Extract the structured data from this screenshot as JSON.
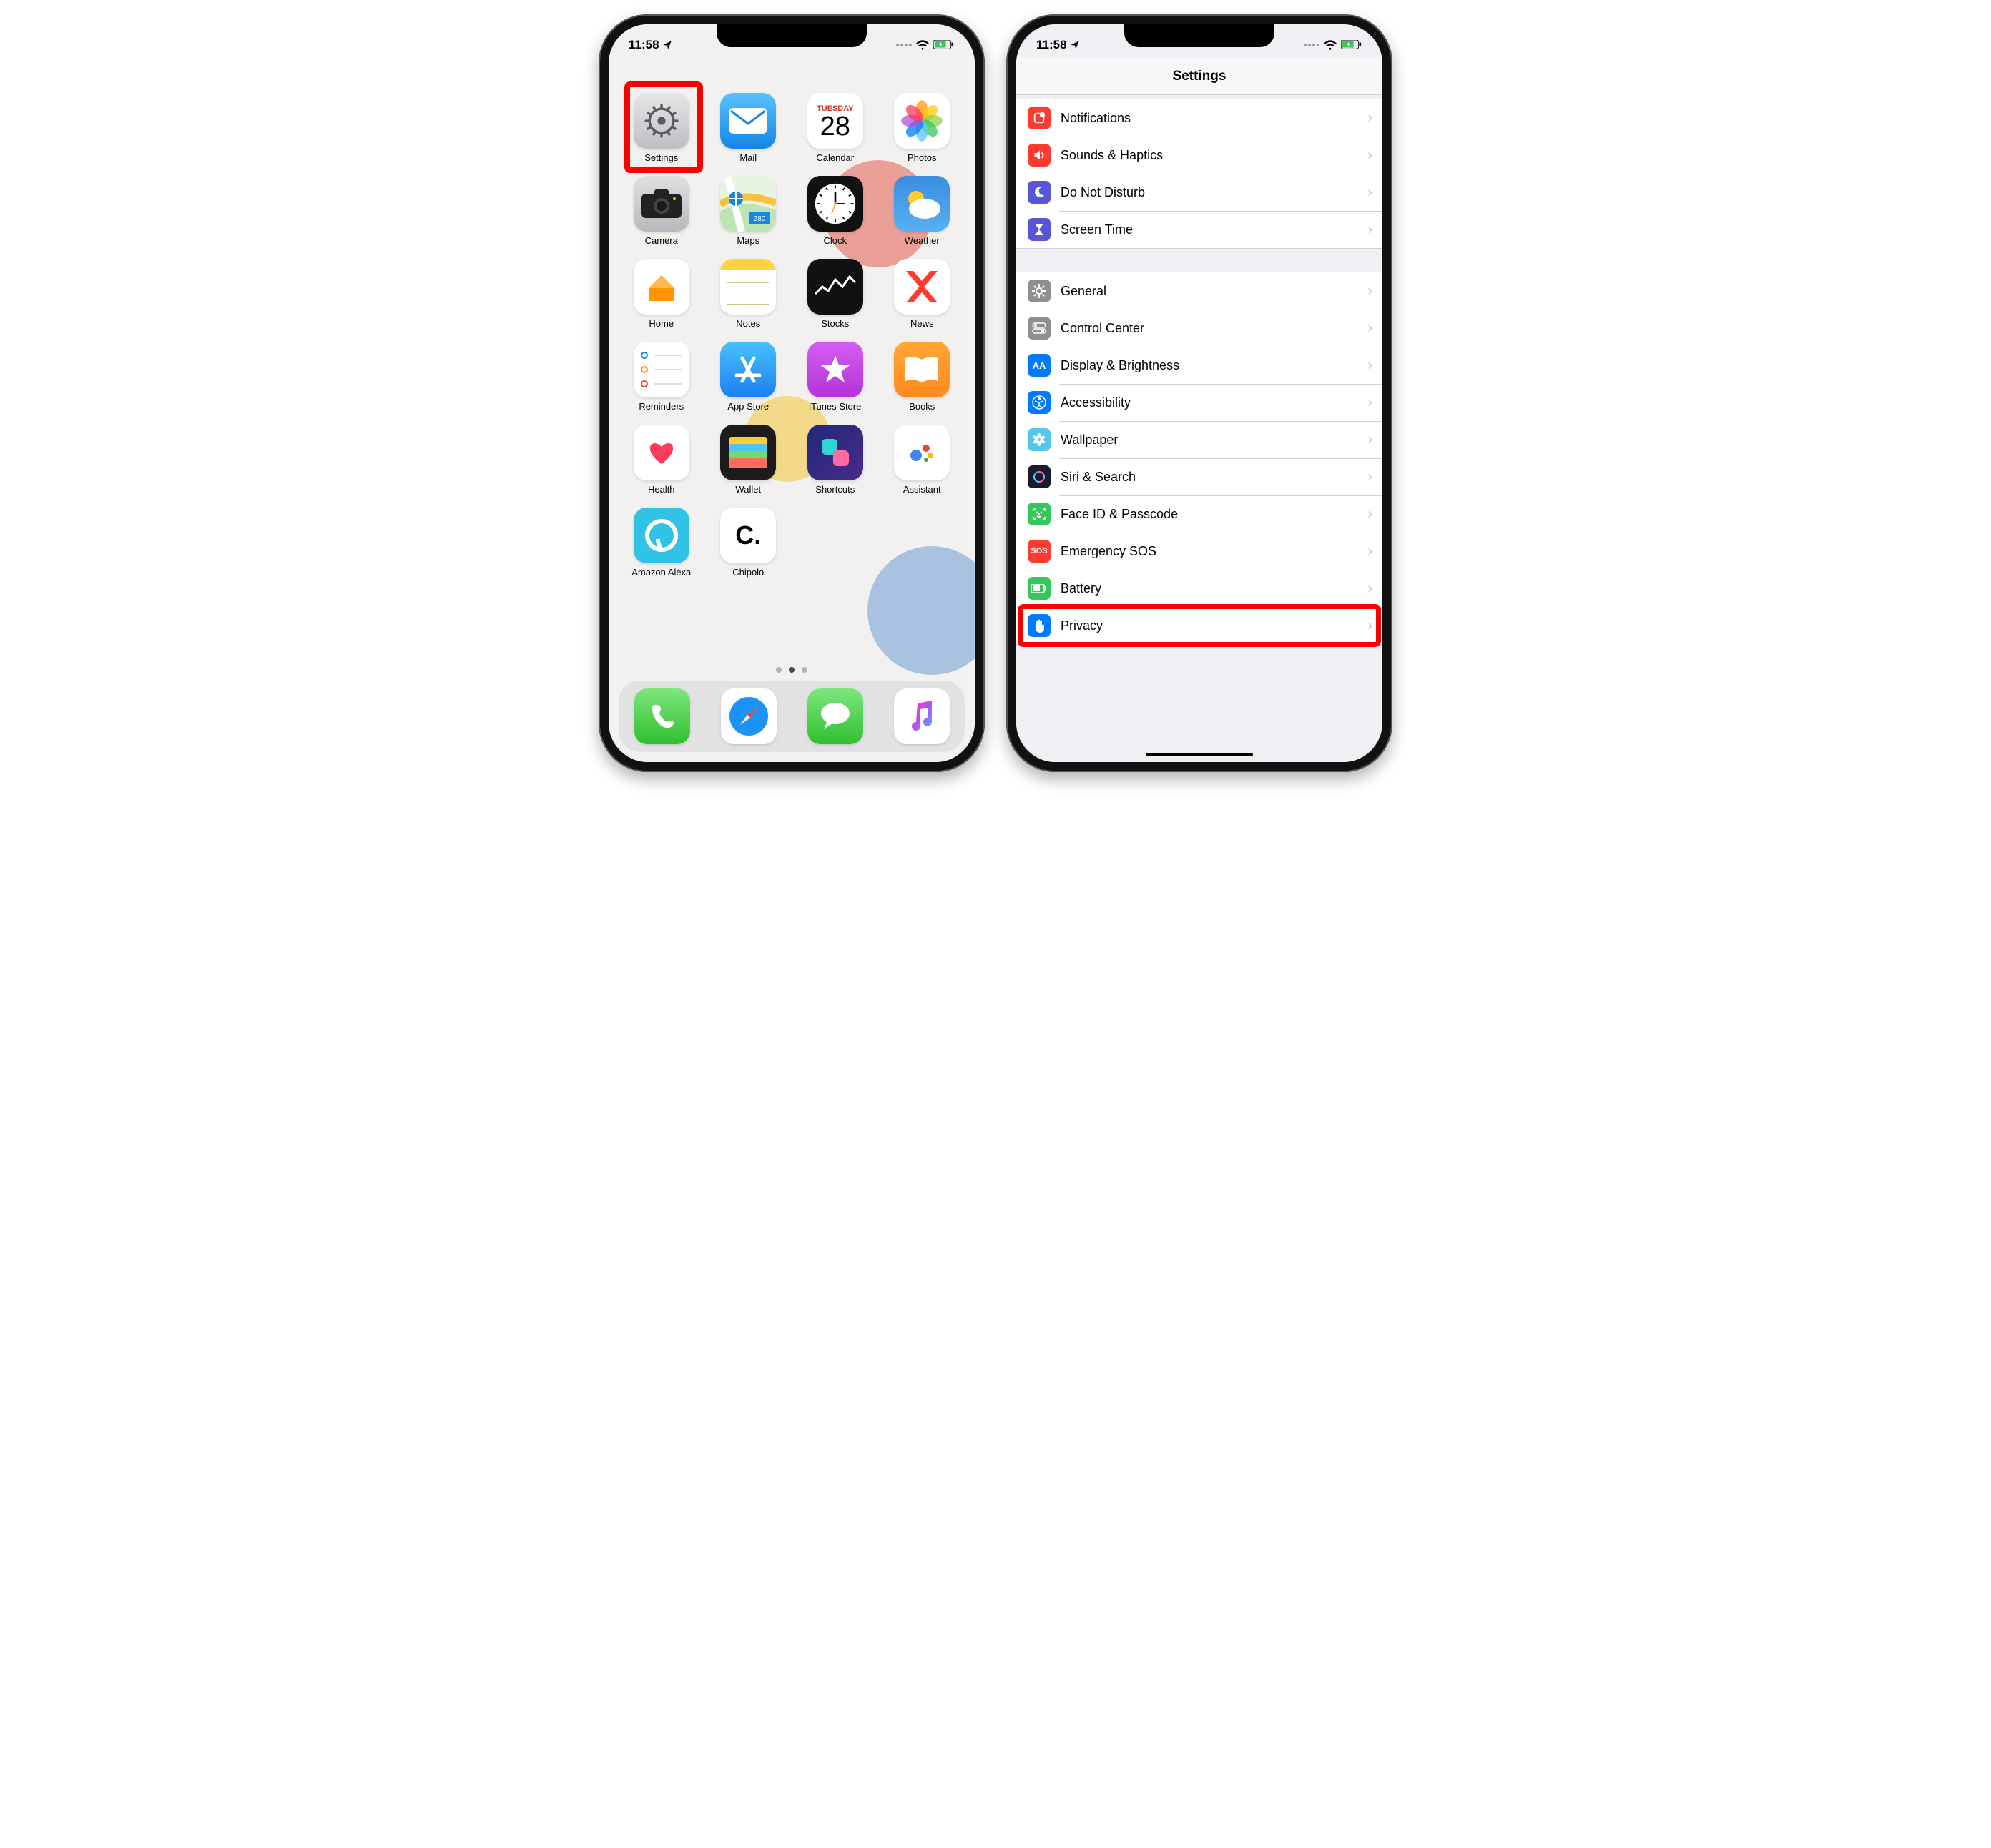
{
  "status": {
    "time": "11:58",
    "loc_arrow": "➤"
  },
  "home": {
    "apps": [
      {
        "name": "Settings",
        "highlighted": true
      },
      {
        "name": "Mail"
      },
      {
        "name": "Calendar",
        "day": "Tuesday",
        "num": "28"
      },
      {
        "name": "Photos"
      },
      {
        "name": "Camera"
      },
      {
        "name": "Maps"
      },
      {
        "name": "Clock"
      },
      {
        "name": "Weather"
      },
      {
        "name": "Home"
      },
      {
        "name": "Notes"
      },
      {
        "name": "Stocks"
      },
      {
        "name": "News"
      },
      {
        "name": "Reminders"
      },
      {
        "name": "App Store"
      },
      {
        "name": "iTunes Store"
      },
      {
        "name": "Books"
      },
      {
        "name": "Health"
      },
      {
        "name": "Wallet"
      },
      {
        "name": "Shortcuts"
      },
      {
        "name": "Assistant"
      },
      {
        "name": "Amazon Alexa"
      },
      {
        "name": "Chipolo"
      }
    ],
    "dock": [
      {
        "name": "Phone"
      },
      {
        "name": "Safari"
      },
      {
        "name": "Messages"
      },
      {
        "name": "Music"
      }
    ]
  },
  "settings": {
    "title": "Settings",
    "groups": [
      [
        {
          "label": "Notifications",
          "icon": "notifications",
          "color": "#ff3b30"
        },
        {
          "label": "Sounds & Haptics",
          "icon": "sounds",
          "color": "#ff3b30"
        },
        {
          "label": "Do Not Disturb",
          "icon": "moon",
          "color": "#5856d6"
        },
        {
          "label": "Screen Time",
          "icon": "hourglass",
          "color": "#5856d6"
        }
      ],
      [
        {
          "label": "General",
          "icon": "gear",
          "color": "#8e8e93"
        },
        {
          "label": "Control Center",
          "icon": "switches",
          "color": "#8e8e93"
        },
        {
          "label": "Display & Brightness",
          "icon": "AA",
          "color": "#007aff"
        },
        {
          "label": "Accessibility",
          "icon": "accessibility",
          "color": "#007aff"
        },
        {
          "label": "Wallpaper",
          "icon": "flower",
          "color": "#54c7ec"
        },
        {
          "label": "Siri & Search",
          "icon": "siri",
          "color": "#1b1b2e"
        },
        {
          "label": "Face ID & Passcode",
          "icon": "faceid",
          "color": "#34c759"
        },
        {
          "label": "Emergency SOS",
          "icon": "SOS",
          "color": "#ff3b30"
        },
        {
          "label": "Battery",
          "icon": "battery",
          "color": "#34c759"
        },
        {
          "label": "Privacy",
          "icon": "hand",
          "color": "#007aff",
          "highlighted": true
        }
      ]
    ]
  }
}
